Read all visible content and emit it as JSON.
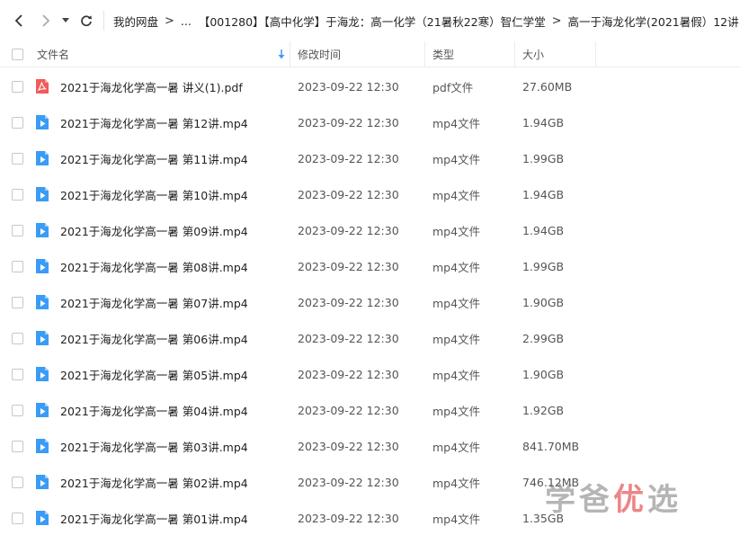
{
  "breadcrumb": {
    "items": [
      "我的网盘",
      "...",
      "【001280】【高中化学】于海龙：高一化学（21暑秋22寒）智仁学堂",
      "高一于海龙化学(2021暑假）12讲"
    ],
    "separator": ">"
  },
  "table": {
    "columns": {
      "name": "文件名",
      "time": "修改时间",
      "type": "类型",
      "size": "大小"
    },
    "rows": [
      {
        "name": "2021于海龙化学高一暑 讲义(1).pdf",
        "time": "2023-09-22 12:30",
        "type": "pdf文件",
        "size": "27.60MB",
        "icon": "pdf-icon"
      },
      {
        "name": "2021于海龙化学高一暑 第12讲.mp4",
        "time": "2023-09-22 12:30",
        "type": "mp4文件",
        "size": "1.94GB",
        "icon": "video-icon"
      },
      {
        "name": "2021于海龙化学高一暑 第11讲.mp4",
        "time": "2023-09-22 12:30",
        "type": "mp4文件",
        "size": "1.99GB",
        "icon": "video-icon"
      },
      {
        "name": "2021于海龙化学高一暑 第10讲.mp4",
        "time": "2023-09-22 12:30",
        "type": "mp4文件",
        "size": "1.94GB",
        "icon": "video-icon"
      },
      {
        "name": "2021于海龙化学高一暑 第09讲.mp4",
        "time": "2023-09-22 12:30",
        "type": "mp4文件",
        "size": "1.94GB",
        "icon": "video-icon"
      },
      {
        "name": "2021于海龙化学高一暑 第08讲.mp4",
        "time": "2023-09-22 12:30",
        "type": "mp4文件",
        "size": "1.99GB",
        "icon": "video-icon"
      },
      {
        "name": "2021于海龙化学高一暑 第07讲.mp4",
        "time": "2023-09-22 12:30",
        "type": "mp4文件",
        "size": "1.90GB",
        "icon": "video-icon"
      },
      {
        "name": "2021于海龙化学高一暑 第06讲.mp4",
        "time": "2023-09-22 12:30",
        "type": "mp4文件",
        "size": "2.99GB",
        "icon": "video-icon"
      },
      {
        "name": "2021于海龙化学高一暑 第05讲.mp4",
        "time": "2023-09-22 12:30",
        "type": "mp4文件",
        "size": "1.90GB",
        "icon": "video-icon"
      },
      {
        "name": "2021于海龙化学高一暑 第04讲.mp4",
        "time": "2023-09-22 12:30",
        "type": "mp4文件",
        "size": "1.92GB",
        "icon": "video-icon"
      },
      {
        "name": "2021于海龙化学高一暑 第03讲.mp4",
        "time": "2023-09-22 12:30",
        "type": "mp4文件",
        "size": "841.70MB",
        "icon": "video-icon"
      },
      {
        "name": "2021于海龙化学高一暑 第02讲.mp4",
        "time": "2023-09-22 12:30",
        "type": "mp4文件",
        "size": "746.12MB",
        "icon": "video-icon"
      },
      {
        "name": "2021于海龙化学高一暑 第01讲.mp4",
        "time": "2023-09-22 12:30",
        "type": "mp4文件",
        "size": "1.35GB",
        "icon": "video-icon"
      }
    ]
  },
  "watermark": {
    "part1": "学爸",
    "part2": "优",
    "part3": "选"
  },
  "colors": {
    "video_icon": "#3b9cf5",
    "pdf_icon": "#f15b5b",
    "sort_arrow": "#3b9cf5"
  }
}
